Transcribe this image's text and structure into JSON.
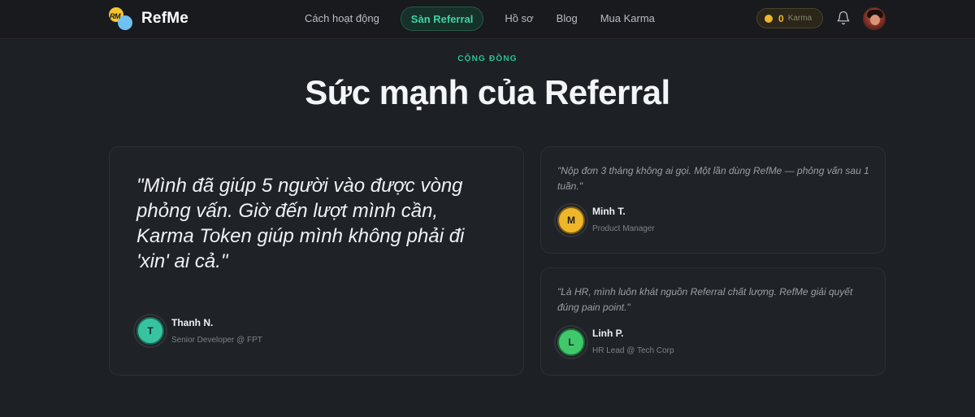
{
  "brand": {
    "logo_text": "RM",
    "name": "RefMe"
  },
  "nav": {
    "items": [
      {
        "label": "Cách hoạt động",
        "active": false
      },
      {
        "label": "Sàn Referral",
        "active": true
      },
      {
        "label": "Hồ sơ",
        "active": false
      },
      {
        "label": "Blog",
        "active": false
      },
      {
        "label": "Mua Karma",
        "active": false
      }
    ],
    "karma": {
      "value": "0",
      "label": "Karma"
    }
  },
  "section": {
    "eyebrow": "CỘNG ĐỒNG",
    "title": "Sức mạnh của Referral"
  },
  "testimonials": {
    "featured": {
      "quote": "\"Mình đã giúp 5 người vào được vòng phỏng vấn. Giờ đến lượt mình cần, Karma Token giúp mình không phải đi 'xin' ai cả.\"",
      "initial": "T",
      "name": "Thanh N.",
      "role": "Senior Developer @ FPT"
    },
    "small": [
      {
        "quote": "\"Nộp đơn 3 tháng không ai gọi. Một lần dùng RefMe — phỏng vấn sau 1 tuần.\"",
        "initial": "M",
        "name": "Minh T.",
        "role": "Product Manager"
      },
      {
        "quote": "\"Là HR, mình luôn khát nguồn Referral chất lượng. RefMe giải quyết đúng pain point.\"",
        "initial": "L",
        "name": "Linh P.",
        "role": "HR Lead @ Tech Corp"
      }
    ]
  },
  "colors": {
    "accent": "#3ed3a5",
    "karma": "#f0b62b",
    "background": "#1d2025"
  }
}
